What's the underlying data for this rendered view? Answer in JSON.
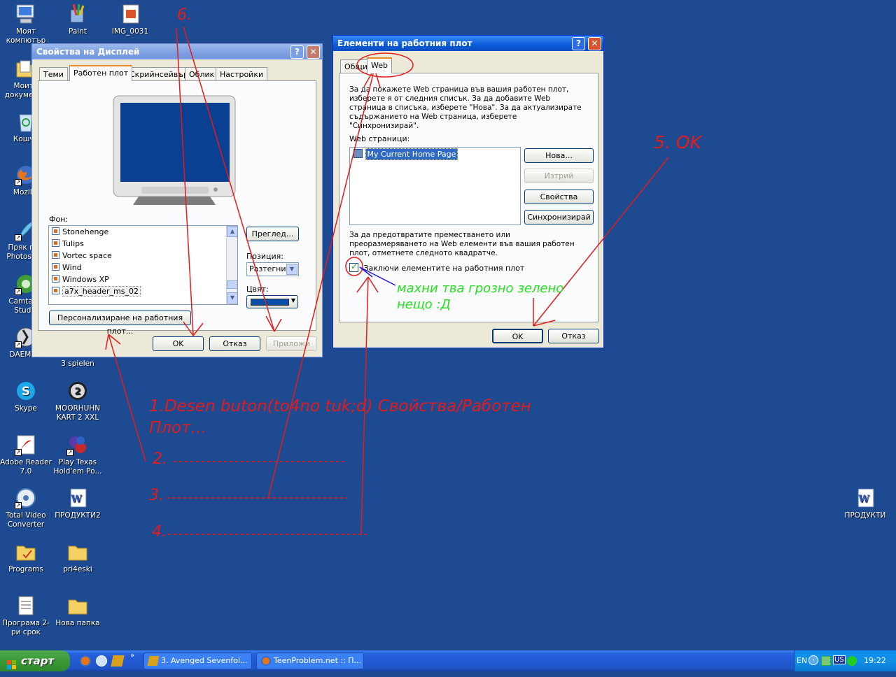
{
  "desktop_icons_left": [
    {
      "label": "Моят компютър"
    },
    {
      "label": "Моите документи"
    },
    {
      "label": "Кошче"
    },
    {
      "label": "Mozilla Firefox"
    },
    {
      "label": "Пряк път Photoshop"
    },
    {
      "label": "Camtasia Studio"
    },
    {
      "label": "DAEMON"
    },
    {
      "label": "Skype"
    },
    {
      "label": "Adobe Reader 7.0"
    },
    {
      "label": "Total Video Converter"
    },
    {
      "label": "Programs"
    },
    {
      "label": "Програма 2-ри срок"
    }
  ],
  "desktop_icons_right_col": [
    {
      "label": "Paint"
    },
    {
      "label": "3 spielen"
    },
    {
      "label": "MOORHUHN KART 2 XXL"
    },
    {
      "label": "Play Texas Hold'em Po..."
    },
    {
      "label": "ПРОДУКТИ2"
    },
    {
      "label": "pri4eski"
    },
    {
      "label": "Нова папка"
    }
  ],
  "desktop_icon_img": {
    "label": "IMG_0031"
  },
  "desktop_icon_products": {
    "label": "ПРОДУКТИ"
  },
  "display_dialog": {
    "title": "Свойства на Дисплей",
    "tabs": [
      "Теми",
      "Работен плот",
      "Скрийнсейвър",
      "Облик",
      "Настройки"
    ],
    "background_label": "Фон:",
    "backgrounds": [
      "Stonehenge",
      "Tulips",
      "Vortec space",
      "Wind",
      "Windows XP",
      "a7x_header_ms_02"
    ],
    "browse_button": "Преглед...",
    "position_label": "Позиция:",
    "position_value": "Разтегни",
    "color_label": "Цвят:",
    "color_value": "#0a4fa8",
    "customize_button": "Персонализиране на работния плот...",
    "ok": "OK",
    "cancel": "Отказ",
    "apply": "Приложи"
  },
  "desktop_items_dialog": {
    "title": "Елементи на работния плот",
    "tabs": [
      "Общи",
      "Web"
    ],
    "intro": "За да покажете Web страница във вашия работен плот, изберете я от следния списък. За да добавите Web страница в списъка, изберете \"Нова\". За да актуализирате съдържанието на Web страница, изберете \"Синхронизирай\".",
    "web_pages_label": "Web страници:",
    "web_pages": [
      "My Current Home Page"
    ],
    "btn_new": "Нова...",
    "btn_delete": "Изтрий",
    "btn_properties": "Свойства",
    "btn_sync": "Синхронизирай",
    "lock_text": "За да предотвратите преместването или преоразмеряването на Web елементи във вашия работен плот, отметнете следното квадратче.",
    "lock_checkbox": "Заключи елементите на работния плот",
    "ok": "OK",
    "cancel": "Отказ"
  },
  "annotations": {
    "step1": "1.Desen buton(to4no tuk;d) Свойства/Работен Плот...",
    "step2": "2.",
    "step3": "3.",
    "step4": "4.",
    "step5": "5. OK",
    "step6": "6.",
    "green_note": "махни тва грозно зелено нещо :Д"
  },
  "taskbar": {
    "start": "старт",
    "tasks": [
      "3. Avenged Sevenfol...",
      "TeenProblem.net :: П..."
    ],
    "lang": "EN",
    "layout": "US",
    "time": "19:22"
  }
}
